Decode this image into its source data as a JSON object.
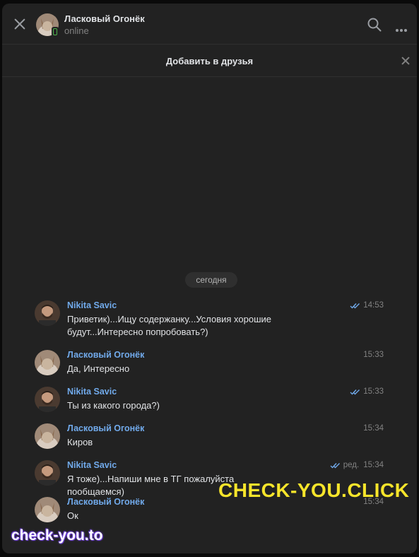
{
  "header": {
    "name": "Ласковый Огонёк",
    "status": "online"
  },
  "friend_bar": {
    "label": "Добавить в друзья"
  },
  "date_separator": "сегодня",
  "messages": [
    {
      "author": "Nikita Savic",
      "text": "Приветик)...Ищу содержанку...Условия хорошие будут...Интересно попробовать?)",
      "time": "14:53",
      "read_ticks": true,
      "edited": "",
      "avatar": "nikita"
    },
    {
      "author": "Ласковый Огонёк",
      "text": "Да, Интересно",
      "time": "15:33",
      "read_ticks": false,
      "edited": "",
      "avatar": "ogonek"
    },
    {
      "author": "Nikita Savic",
      "text": "Ты из какого города?)",
      "time": "15:33",
      "read_ticks": true,
      "edited": "",
      "avatar": "nikita"
    },
    {
      "author": "Ласковый Огонёк",
      "text": "Киров",
      "time": "15:34",
      "read_ticks": false,
      "edited": "",
      "avatar": "ogonek"
    },
    {
      "author": "Nikita Savic",
      "text": "Я тоже)...Напиши мне в ТГ пожалуйста пообщаемся)",
      "time": "15:34",
      "read_ticks": true,
      "edited": "ред.",
      "avatar": "nikita"
    },
    {
      "author": "Ласковый Огонёк",
      "text": "Ок",
      "time": "15:34",
      "read_ticks": false,
      "edited": "",
      "avatar": "ogonek"
    }
  ],
  "watermarks": {
    "large": "CHECK-YOU.CLICK",
    "small": "check-you.to"
  },
  "colors": {
    "background": "#222222",
    "author_link": "#71aaeb",
    "online": "#4bb34b",
    "watermark_large": "#f7e52b",
    "watermark_small_outline": "#6b3fd0"
  },
  "icons": {
    "close": "close-icon",
    "search": "search-icon",
    "more": "more-icon",
    "read": "double-check-icon"
  }
}
